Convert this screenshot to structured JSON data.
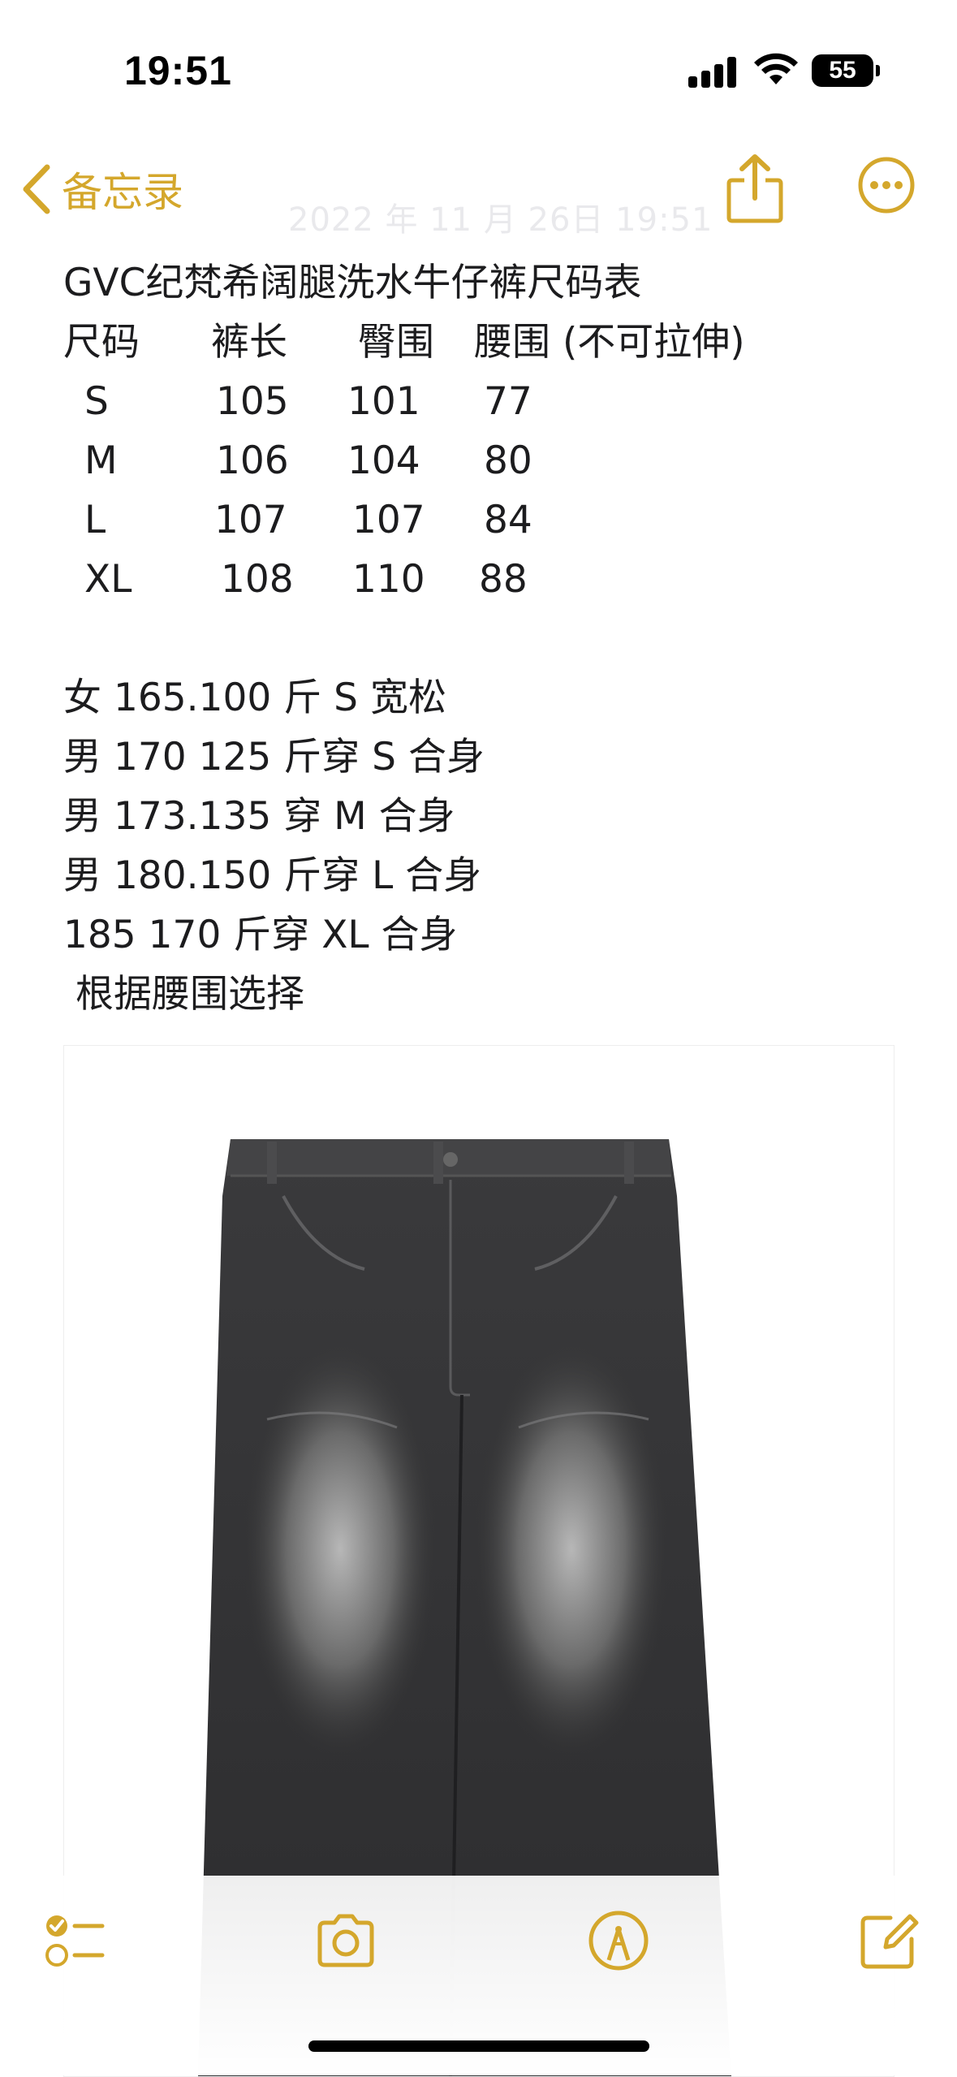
{
  "status_bar": {
    "time": "19:51",
    "battery": "55"
  },
  "nav": {
    "back_label": "备忘录",
    "share_icon": "share-icon",
    "more_icon": "ellipsis-circle-icon",
    "accent": "#d4a72c"
  },
  "note": {
    "date": "2022 年 11 月 26日 19:51",
    "title": "GVC纪梵希阔腿洗水牛仔裤尺码表",
    "table_headers": [
      "尺码",
      "裤长",
      "臀围",
      "腰围 (不可拉伸)"
    ],
    "table_rows": [
      [
        "S",
        "105",
        "101",
        "77"
      ],
      [
        "M",
        "106",
        "104",
        "80"
      ],
      [
        "L",
        "107",
        "107",
        "84"
      ],
      [
        "XL",
        "108",
        "110",
        "88"
      ]
    ],
    "recommendations": [
      "女 165.100 斤 S 宽松",
      "男 170 125 斤穿 S 合身",
      "男 173.135 穿 M 合身",
      "男 180.150 斤穿 L 合身",
      "185 170 斤穿 XL 合身",
      " 根据腰围选择"
    ]
  },
  "attachment": {
    "image_icon": "jeans-photo"
  },
  "toolbar": {
    "icons": [
      "checklist-icon",
      "camera-icon",
      "markup-icon",
      "compose-icon"
    ]
  }
}
